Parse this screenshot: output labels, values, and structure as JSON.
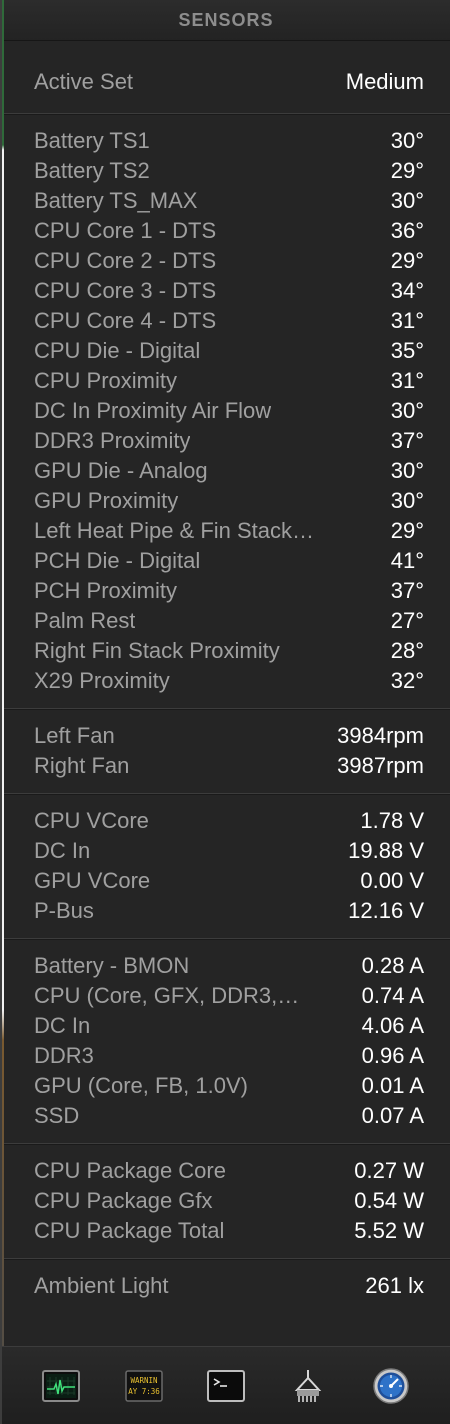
{
  "header": {
    "title": "SENSORS"
  },
  "active_set": {
    "label": "Active Set",
    "value": "Medium"
  },
  "temperatures": [
    {
      "label": "Battery TS1",
      "value": "30°"
    },
    {
      "label": "Battery TS2",
      "value": "29°"
    },
    {
      "label": "Battery TS_MAX",
      "value": "30°"
    },
    {
      "label": "CPU Core 1 - DTS",
      "value": "36°"
    },
    {
      "label": "CPU Core 2 - DTS",
      "value": "29°"
    },
    {
      "label": "CPU Core 3 - DTS",
      "value": "34°"
    },
    {
      "label": "CPU Core 4 - DTS",
      "value": "31°"
    },
    {
      "label": "CPU Die - Digital",
      "value": "35°"
    },
    {
      "label": "CPU Proximity",
      "value": "31°"
    },
    {
      "label": "DC In Proximity Air Flow",
      "value": "30°"
    },
    {
      "label": "DDR3 Proximity",
      "value": "37°"
    },
    {
      "label": "GPU Die - Analog",
      "value": "30°"
    },
    {
      "label": "GPU Proximity",
      "value": "30°"
    },
    {
      "label": "Left Heat Pipe & Fin Stack…",
      "value": "29°"
    },
    {
      "label": "PCH Die - Digital",
      "value": "41°"
    },
    {
      "label": "PCH Proximity",
      "value": "37°"
    },
    {
      "label": "Palm Rest",
      "value": "27°"
    },
    {
      "label": "Right Fin Stack Proximity",
      "value": "28°"
    },
    {
      "label": "X29 Proximity",
      "value": "32°"
    }
  ],
  "fans": [
    {
      "label": "Left Fan",
      "value": "3984rpm"
    },
    {
      "label": "Right Fan",
      "value": "3987rpm"
    }
  ],
  "voltages": [
    {
      "label": "CPU VCore",
      "value": "1.78 V"
    },
    {
      "label": "DC In",
      "value": "19.88 V"
    },
    {
      "label": "GPU VCore",
      "value": "0.00 V"
    },
    {
      "label": "P-Bus",
      "value": "12.16 V"
    }
  ],
  "currents": [
    {
      "label": "Battery - BMON",
      "value": "0.28 A"
    },
    {
      "label": "CPU (Core, GFX, DDR3,…",
      "value": "0.74 A"
    },
    {
      "label": "DC In",
      "value": "4.06 A"
    },
    {
      "label": "DDR3",
      "value": "0.96 A"
    },
    {
      "label": "GPU (Core, FB, 1.0V)",
      "value": "0.01 A"
    },
    {
      "label": "SSD",
      "value": "0.07 A"
    }
  ],
  "power": [
    {
      "label": "CPU Package Core",
      "value": "0.27 W"
    },
    {
      "label": "CPU Package Gfx",
      "value": "0.54 W"
    },
    {
      "label": "CPU Package Total",
      "value": "5.52 W"
    }
  ],
  "light": [
    {
      "label": "Ambient Light",
      "value": "261 lx"
    }
  ],
  "footer": {
    "buttons": [
      {
        "icon": "activity-monitor-icon",
        "text": ""
      },
      {
        "icon": "console-warning-icon",
        "line1": "WARNIN",
        "line2": "AY 7:36"
      },
      {
        "icon": "terminal-icon",
        "text": ""
      },
      {
        "icon": "system-information-icon",
        "text": ""
      },
      {
        "icon": "disk-utility-icon",
        "text": ""
      }
    ]
  }
}
